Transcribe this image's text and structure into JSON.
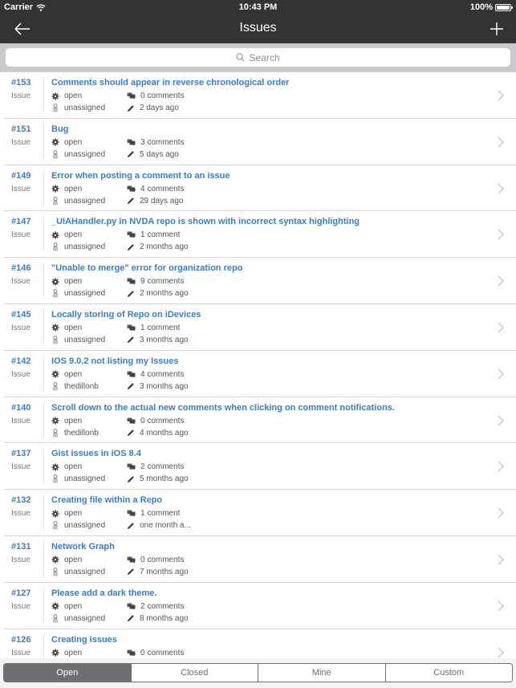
{
  "status_bar": {
    "carrier": "Carrier",
    "time": "10:43 PM",
    "battery": "100%"
  },
  "nav": {
    "title": "Issues",
    "back_icon": "arrow-left-icon",
    "add_icon": "plus-icon"
  },
  "search": {
    "placeholder": "Search"
  },
  "colors": {
    "accent": "#3a7cc5",
    "nav_bg": "#333333",
    "segment_active": "#6e6e73"
  },
  "issues": [
    {
      "number": "#153",
      "type": "Issue",
      "title": "Comments should appear in reverse chronological order",
      "state": "open",
      "assignee": "unassigned",
      "comments": "0 comments",
      "updated": "2 days ago"
    },
    {
      "number": "#151",
      "type": "Issue",
      "title": "Bug",
      "state": "open",
      "assignee": "unassigned",
      "comments": "3 comments",
      "updated": "5 days ago"
    },
    {
      "number": "#149",
      "type": "Issue",
      "title": "Error when posting a comment to an issue",
      "state": "open",
      "assignee": "unassigned",
      "comments": "4 comments",
      "updated": "29 days ago"
    },
    {
      "number": "#147",
      "type": "Issue",
      "title": "_UIAHandler.py in NVDA repo is shown with incorrect syntax highlighting",
      "state": "open",
      "assignee": "unassigned",
      "comments": "1 comment",
      "updated": "2 months ago"
    },
    {
      "number": "#146",
      "type": "Issue",
      "title": "\"Unable to merge\" error for organization repo",
      "state": "open",
      "assignee": "unassigned",
      "comments": "9 comments",
      "updated": "2 months ago"
    },
    {
      "number": "#145",
      "type": "Issue",
      "title": "Locally storing of Repo on iDevices",
      "state": "open",
      "assignee": "unassigned",
      "comments": "1 comment",
      "updated": "3 months ago"
    },
    {
      "number": "#142",
      "type": "Issue",
      "title": "IOS 9.0.2 not listing my Issues",
      "state": "open",
      "assignee": "thedillonb",
      "comments": "4 comments",
      "updated": "3 months ago"
    },
    {
      "number": "#140",
      "type": "Issue",
      "title": "Scroll down to the actual new comments when clicking on comment notifications.",
      "state": "open",
      "assignee": "thedillonb",
      "comments": "0 comments",
      "updated": "4 months ago"
    },
    {
      "number": "#137",
      "type": "Issue",
      "title": "Gist issues in iOS 8.4",
      "state": "open",
      "assignee": "unassigned",
      "comments": "2 comments",
      "updated": "5 months ago"
    },
    {
      "number": "#132",
      "type": "Issue",
      "title": "Creating file within a Repo",
      "state": "open",
      "assignee": "unassigned",
      "comments": "1 comment",
      "updated": "one month a..."
    },
    {
      "number": "#131",
      "type": "Issue",
      "title": "Network Graph",
      "state": "open",
      "assignee": "unassigned",
      "comments": "0 comments",
      "updated": "7 months ago"
    },
    {
      "number": "#127",
      "type": "Issue",
      "title": "Please add a dark theme.",
      "state": "open",
      "assignee": "unassigned",
      "comments": "2 comments",
      "updated": "8 months ago"
    },
    {
      "number": "#126",
      "type": "Issue",
      "title": "Creating issues",
      "state": "open",
      "assignee": "",
      "comments": "0 comments",
      "updated": ""
    }
  ],
  "filter_tabs": [
    {
      "label": "Open",
      "active": true
    },
    {
      "label": "Closed",
      "active": false
    },
    {
      "label": "Mine",
      "active": false
    },
    {
      "label": "Custom",
      "active": false
    }
  ]
}
